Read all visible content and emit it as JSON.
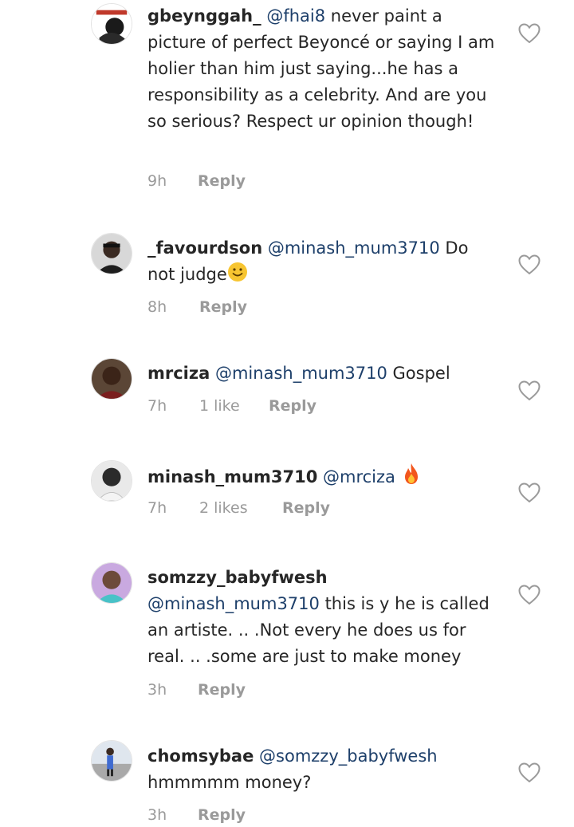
{
  "comments": [
    {
      "username": "gbeynggah_",
      "mention": "@fhai8",
      "text": " never paint a picture of perfect Beyoncé or saying I am holier than him just saying...he has a responsibility as a celebrity.  And are you so serious? Respect ur opinion though!",
      "time": "9h",
      "likes": "",
      "reply": "Reply"
    },
    {
      "username": "_favourdson",
      "mention": "@minash_mum3710",
      "text": " Do not judge",
      "emoji": "smile",
      "time": "8h",
      "likes": "",
      "reply": "Reply"
    },
    {
      "username": "mrciza",
      "mention": "@minash_mum3710",
      "text": " Gospel",
      "time": "7h",
      "likes": "1 like",
      "reply": "Reply"
    },
    {
      "username": "minash_mum3710",
      "mention": "@mrciza",
      "text": " ",
      "emoji": "fire",
      "time": "7h",
      "likes": "2 likes",
      "reply": "Reply"
    },
    {
      "username": "somzzy_babyfwesh",
      "mention": "@minash_mum3710",
      "text": " this is y he is called an artiste. .. .Not every he does us for real. .. .some are just to make money",
      "time": "3h",
      "likes": "",
      "reply": "Reply"
    },
    {
      "username": "chomsybae",
      "mention": "@somzzy_babyfwesh",
      "text": " hmmmmm money?",
      "time": "3h",
      "likes": "",
      "reply": "Reply"
    }
  ]
}
